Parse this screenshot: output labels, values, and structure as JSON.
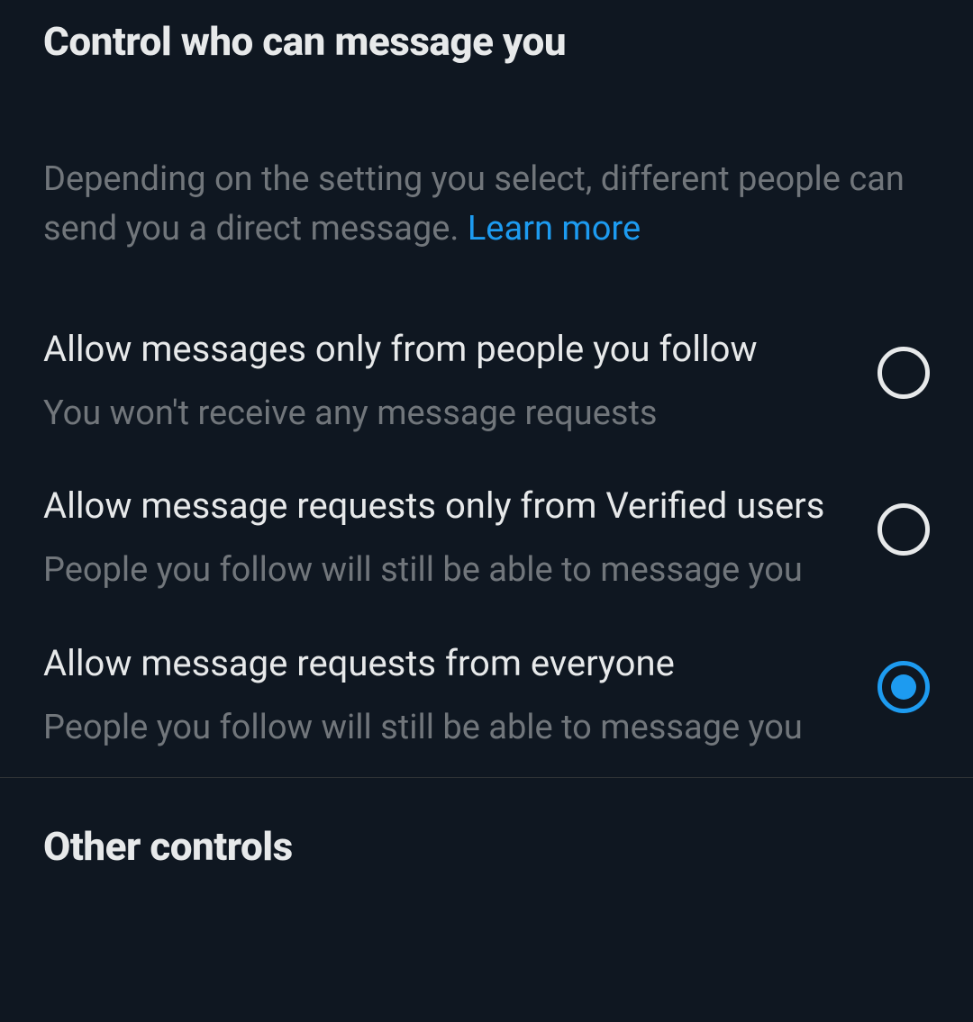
{
  "section1": {
    "title": "Control who can message you",
    "description": "Depending on the setting you select, different people can send you a direct message. ",
    "learn_more": "Learn more"
  },
  "options": [
    {
      "label": "Allow messages only from people you follow",
      "description": "You won't receive any message requests",
      "selected": false
    },
    {
      "label": "Allow message requests only from Verified users",
      "description": "People you follow will still be able to message you",
      "selected": false
    },
    {
      "label": "Allow message requests from everyone",
      "description": "People you follow will still be able to message you",
      "selected": true
    }
  ],
  "section2": {
    "title": "Other controls"
  }
}
